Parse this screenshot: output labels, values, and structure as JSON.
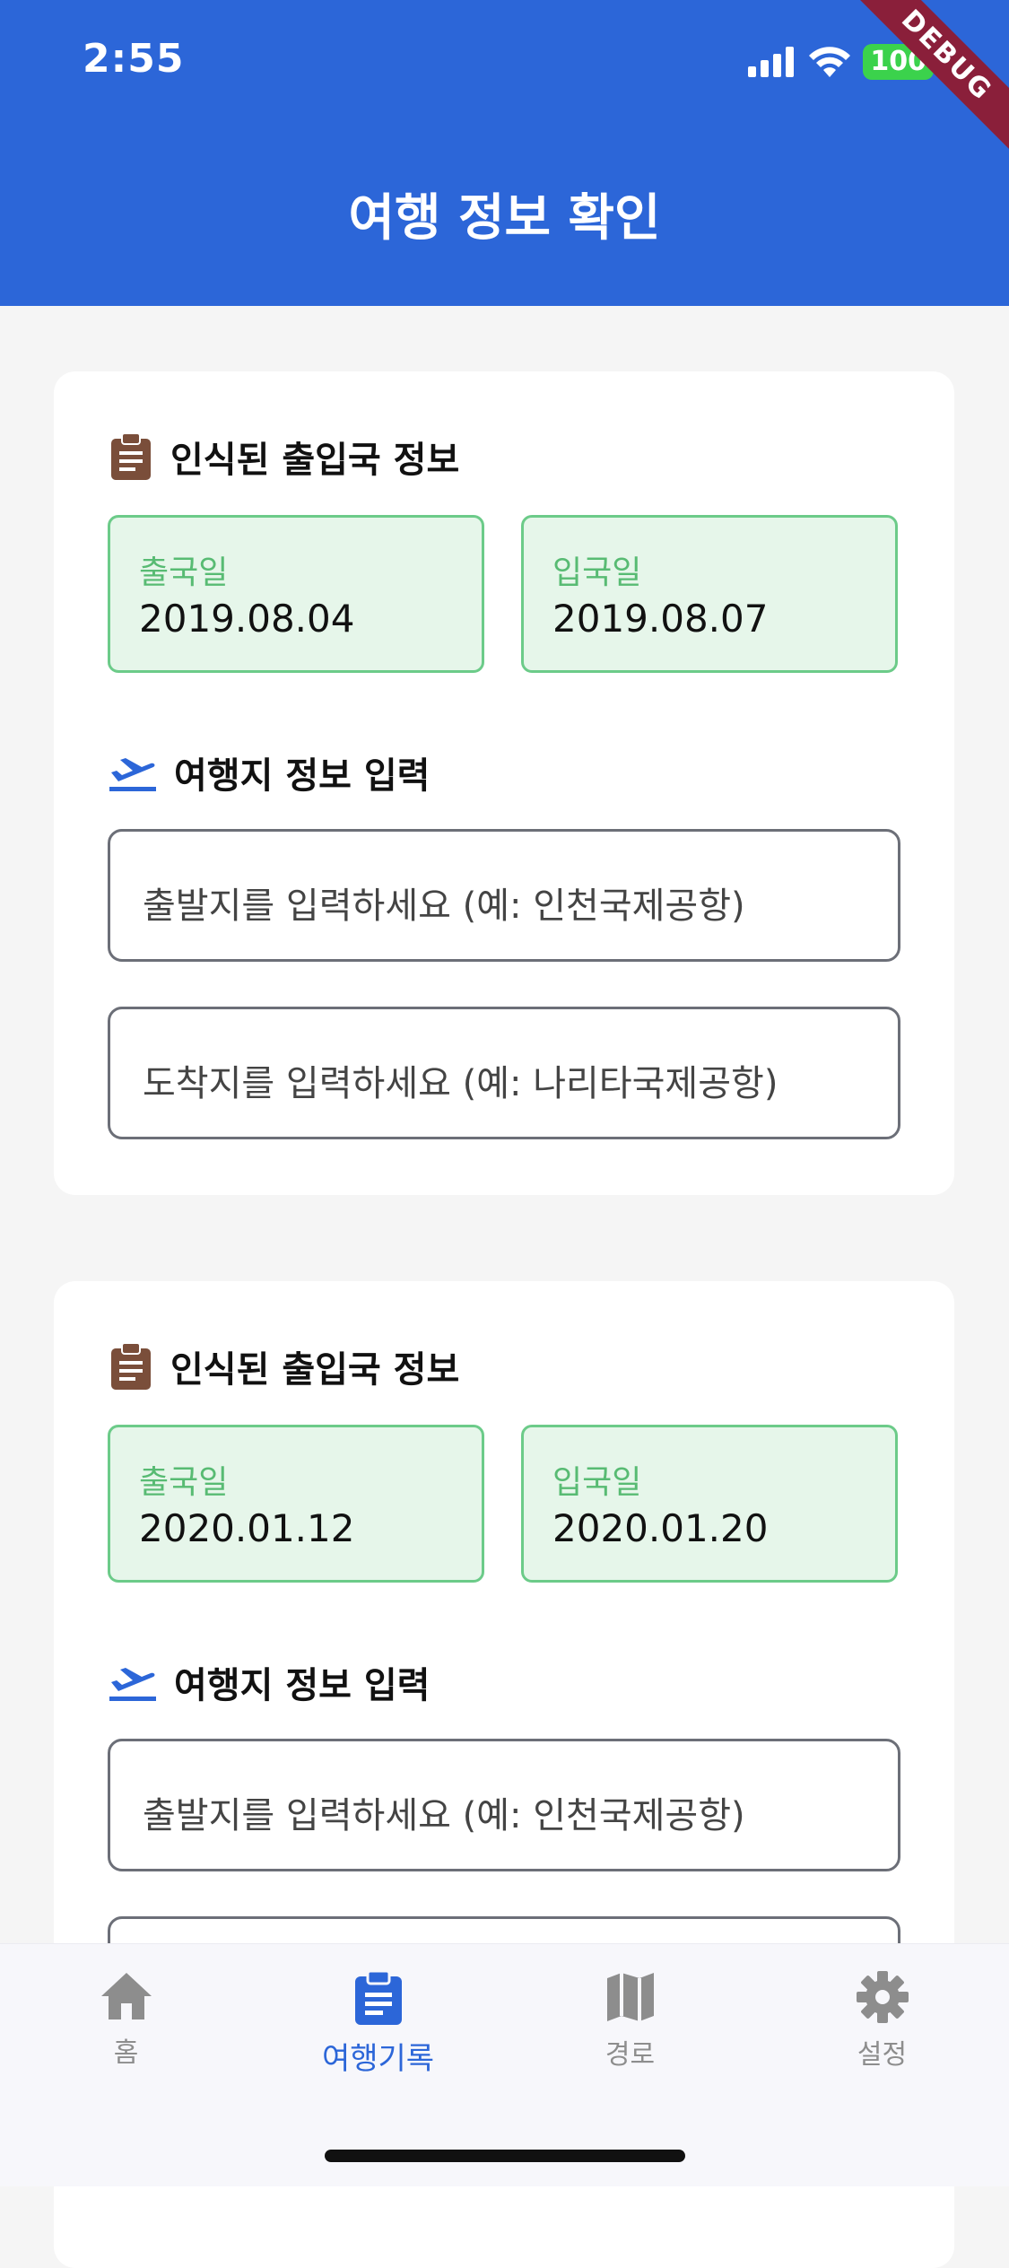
{
  "status_bar": {
    "time": "2:55",
    "battery": "100",
    "debug_ribbon": "DEBUG"
  },
  "app_bar": {
    "title": "여행 정보 확인"
  },
  "cards": [
    {
      "section_recognized": "인식된 출입국 정보",
      "departure_label": "출국일",
      "departure_date": "2019.08.04",
      "entry_label": "입국일",
      "entry_date": "2019.08.07",
      "section_destination": "여행지 정보 입력",
      "origin_placeholder": "출발지를 입력하세요 (예: 인천국제공항)",
      "destination_placeholder": "도착지를 입력하세요 (예: 나리타국제공항)"
    },
    {
      "section_recognized": "인식된 출입국 정보",
      "departure_label": "출국일",
      "departure_date": "2020.01.12",
      "entry_label": "입국일",
      "entry_date": "2020.01.20",
      "section_destination": "여행지 정보 입력",
      "origin_placeholder": "출발지를 입력하세요 (예: 인천국제공항)"
    }
  ],
  "bottom_nav": {
    "items": [
      {
        "label": "홈",
        "icon": "home-icon"
      },
      {
        "label": "여행기록",
        "icon": "clipboard-icon",
        "active": true
      },
      {
        "label": "경로",
        "icon": "map-icon"
      },
      {
        "label": "설정",
        "icon": "gear-icon"
      }
    ]
  },
  "colors": {
    "primary": "#2c66d8",
    "date_box_bg": "#e6f6ea",
    "date_box_border": "#6ccb89",
    "date_label": "#58bb73",
    "clipboard_icon": "#7a4e3a"
  }
}
